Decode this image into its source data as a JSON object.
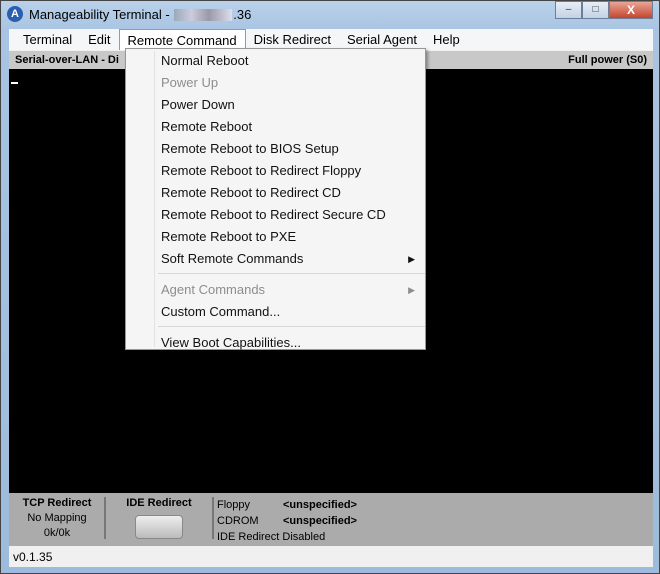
{
  "window": {
    "title": "Manageability Terminal - ",
    "title_suffix": ".36",
    "minimize": "–",
    "maximize": "□",
    "close": "X",
    "app_icon": "A"
  },
  "menubar": [
    "Terminal",
    "Edit",
    "Remote Command",
    "Disk Redirect",
    "Serial Agent",
    "Help"
  ],
  "strip": {
    "left": "Serial-over-LAN - Di",
    "right": "Full power (S0)"
  },
  "menu": {
    "items": [
      {
        "label": "Normal Reboot",
        "disabled": false
      },
      {
        "label": "Power Up",
        "disabled": true
      },
      {
        "label": "Power Down",
        "disabled": false
      },
      {
        "label": "Remote Reboot",
        "disabled": false
      },
      {
        "label": "Remote Reboot to BIOS Setup",
        "disabled": false
      },
      {
        "label": "Remote Reboot to Redirect Floppy",
        "disabled": false
      },
      {
        "label": "Remote Reboot to Redirect CD",
        "disabled": false
      },
      {
        "label": "Remote Reboot to Redirect Secure CD",
        "disabled": false
      },
      {
        "label": "Remote Reboot to PXE",
        "disabled": false
      },
      {
        "label": "Soft Remote Commands",
        "disabled": false
      }
    ],
    "group2": [
      {
        "label": "Agent Commands",
        "disabled": true
      },
      {
        "label": "Custom Command...",
        "disabled": false
      }
    ],
    "group3": [
      {
        "label": "View Boot Capabilities...",
        "disabled": false
      }
    ],
    "submenu_arrow": "▶"
  },
  "panel": {
    "tcp_title": "TCP Redirect",
    "tcp_mapping": "No Mapping",
    "tcp_traffic": "0k/0k",
    "ide_title": "IDE Redirect",
    "floppy_label": "Floppy",
    "floppy_value": "<unspecified>",
    "cdrom_label": "CDROM",
    "cdrom_value": "<unspecified>",
    "ide_status": "IDE Redirect Disabled"
  },
  "status": {
    "version": "v0.1.35"
  }
}
